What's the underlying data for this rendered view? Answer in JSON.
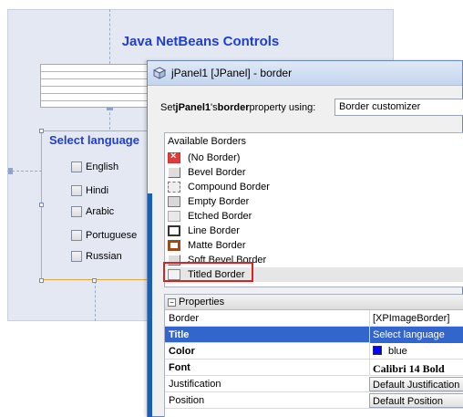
{
  "designer": {
    "title": "Java NetBeans Controls",
    "panel_title": "Select language",
    "languages": [
      "English",
      "Hindi",
      "Arabic",
      "Portuguese",
      "Russian"
    ]
  },
  "dialog": {
    "window_title": "jPanel1 [JPanel] - border",
    "set_prefix": "Set ",
    "set_component": "jPanel1",
    "set_mid": "'s ",
    "set_property": "border",
    "set_suffix": " property using:",
    "customizer_value": "Border customizer",
    "available_borders_header": "Available Borders",
    "borders": [
      {
        "label": "(No Border)",
        "icon": "no-border-icon"
      },
      {
        "label": "Bevel Border",
        "icon": "bevel-border-icon"
      },
      {
        "label": "Compound Border",
        "icon": "compound-border-icon"
      },
      {
        "label": "Empty Border",
        "icon": "empty-border-icon"
      },
      {
        "label": "Etched Border",
        "icon": "etched-border-icon"
      },
      {
        "label": "Line Border",
        "icon": "line-border-icon"
      },
      {
        "label": "Matte Border",
        "icon": "matte-border-icon"
      },
      {
        "label": "Soft Bevel Border",
        "icon": "soft-bevel-border-icon"
      },
      {
        "label": "Titled Border",
        "icon": "titled-border-icon"
      }
    ],
    "selected_border": "Titled Border",
    "properties_header": "Properties",
    "properties": [
      {
        "name": "Border",
        "value": "[XPImageBorder]"
      },
      {
        "name": "Title",
        "value": "Select language"
      },
      {
        "name": "Color",
        "value": "blue"
      },
      {
        "name": "Font",
        "value": "Calibri 14 Bold"
      },
      {
        "name": "Justification",
        "value": "Default Justification"
      },
      {
        "name": "Position",
        "value": "Default Position"
      }
    ],
    "color_swatch": "#0000ff"
  },
  "colors": {
    "title_blue": "#1f3fd0",
    "selection_blue": "#3366cc",
    "highlight_red": "#e02020",
    "panel_border_orange": "#e6a640"
  }
}
